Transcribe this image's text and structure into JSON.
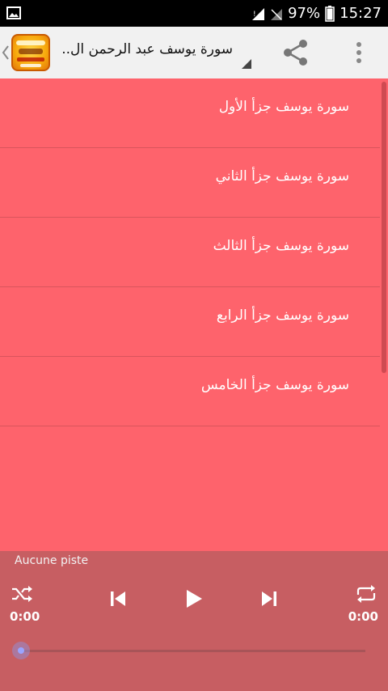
{
  "status_bar": {
    "battery_percent": "97%",
    "time": "15:27"
  },
  "action_bar": {
    "title": "سورة يوسف  عبد الرحمن ال..",
    "icons": {
      "back": "chevron-left-icon",
      "logo": "app-logo",
      "share": "share-icon",
      "more": "more-vert-icon"
    }
  },
  "list": {
    "items": [
      {
        "label": "سورة يوسف جزأ الأول"
      },
      {
        "label": "سورة يوسف جزأ الثاني"
      },
      {
        "label": "سورة يوسف جزأ الثالث"
      },
      {
        "label": "سورة يوسف جزأ الرابع"
      },
      {
        "label": "سورة يوسف جزأ الخامس"
      }
    ]
  },
  "player": {
    "track_name": "Aucune piste",
    "elapsed": "0:00",
    "duration": "0:00",
    "progress_fraction": 0,
    "icons": {
      "shuffle": "shuffle-icon",
      "previous": "skip-previous-icon",
      "play": "play-icon",
      "next": "skip-next-icon",
      "repeat": "repeat-icon"
    }
  },
  "colors": {
    "list_background": "#fe636c",
    "player_background": "#c75e62",
    "action_bar_background": "#f1f1f1",
    "seek_thumb": "#9aa4ff"
  }
}
